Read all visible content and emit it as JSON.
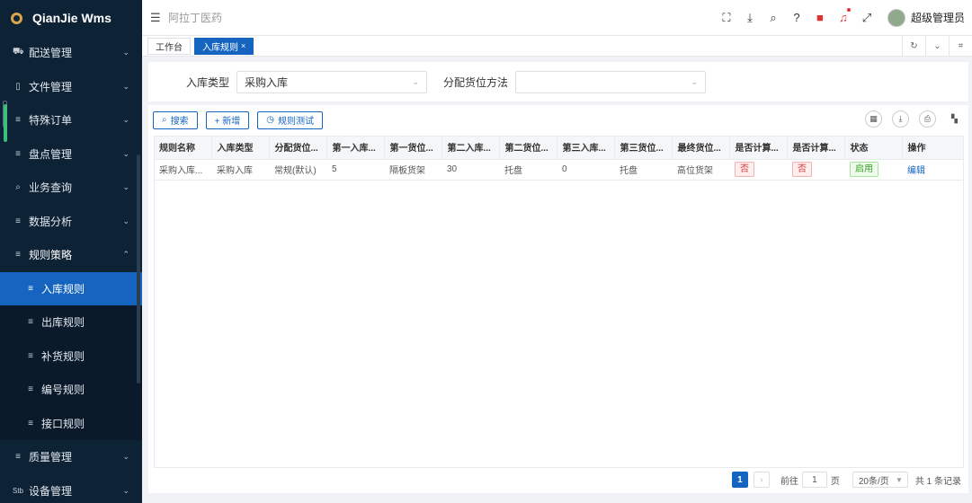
{
  "app": {
    "name": "QianJie Wms",
    "company": "阿拉丁医药",
    "user": "超级管理员"
  },
  "sidebar": {
    "items": [
      {
        "label": "配送管理",
        "icon": "truck-icon"
      },
      {
        "label": "文件管理",
        "icon": "file-icon"
      },
      {
        "label": "特殊订单",
        "icon": "list-icon"
      },
      {
        "label": "盘点管理",
        "icon": "list-icon"
      },
      {
        "label": "业务查询",
        "icon": "search-icon"
      },
      {
        "label": "数据分析",
        "icon": "list-icon"
      },
      {
        "label": "规则策略",
        "icon": "list-icon",
        "expanded": true
      }
    ],
    "sub_items": [
      {
        "label": "入库规则",
        "active": true
      },
      {
        "label": "出库规则"
      },
      {
        "label": "补货规则"
      },
      {
        "label": "编号规则"
      },
      {
        "label": "接口规则"
      }
    ],
    "items_after": [
      {
        "label": "质量管理",
        "icon": "list-icon"
      },
      {
        "label": "设备管理",
        "icon": "device-icon"
      }
    ]
  },
  "tabs": [
    {
      "label": "工作台"
    },
    {
      "label": "入库规则",
      "active": true,
      "close": "×"
    }
  ],
  "filter": {
    "inbound_type_label": "入库类型",
    "inbound_type_value": "采购入库",
    "alloc_method_label": "分配货位方法",
    "alloc_method_value": ""
  },
  "toolbar": {
    "search": "搜索",
    "add": "+ 新增",
    "test": "规则测试"
  },
  "table": {
    "columns": [
      "规则名称",
      "入库类型",
      "分配货位...",
      "第一入库...",
      "第一货位...",
      "第二入库...",
      "第二货位...",
      "第三入库...",
      "第三货位...",
      "最终货位...",
      "是否计算...",
      "是否计算...",
      "状态",
      "操作"
    ],
    "rows": [
      {
        "rule_name": "采购入库...",
        "inbound_type": "采购入库",
        "alloc": "常规(默认)",
        "first_qty": "5",
        "first_loc": "隔板货架",
        "second_qty": "30",
        "second_loc": "托盘",
        "third_qty": "0",
        "third_loc": "托盘",
        "final_loc": "高位货架",
        "calc1": "否",
        "calc2": "否",
        "status": "启用",
        "action": "编辑"
      }
    ]
  },
  "pager": {
    "current": "1",
    "goto_label": "前往",
    "goto_value": "1",
    "page_unit": "页",
    "page_size": "20条/页",
    "total": "共 1 条记录"
  },
  "colors": {
    "sidebar_bg": "#0e2236",
    "accent": "#1565c0",
    "danger": "#e03030",
    "success": "#3aa32a"
  }
}
